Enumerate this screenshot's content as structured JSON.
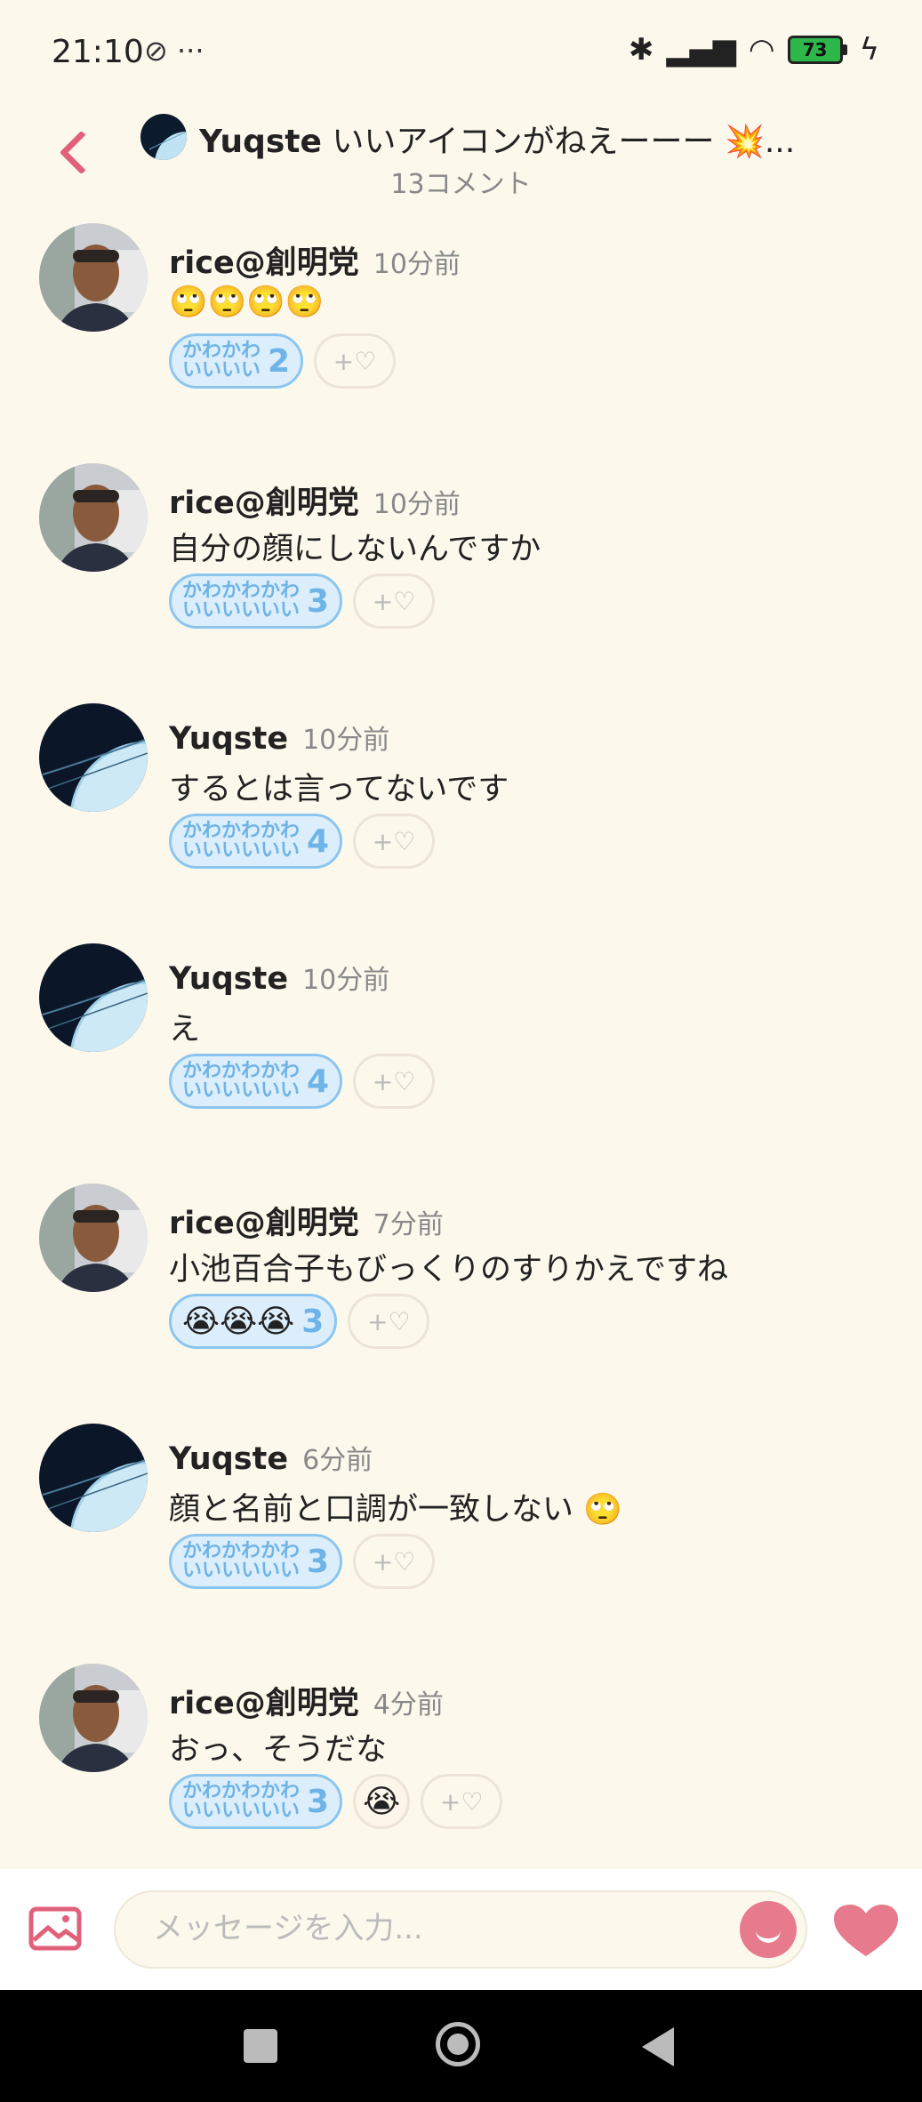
{
  "status_bar": {
    "time": "21:10",
    "battery": "73",
    "more": "···"
  },
  "header": {
    "author": "Yuqste",
    "title": "いいアイコンがねえーーー 💥...",
    "comment_count": "13コメント"
  },
  "comments": [
    {
      "user": "rice@創明党",
      "ago": "10分前",
      "text": "🙄🙄🙄🙄",
      "avatar": "person",
      "reactions": [
        {
          "kind": "kawaii",
          "top": "かわかわ",
          "bottom": "いいいい",
          "count": "2"
        }
      ]
    },
    {
      "user": "rice@創明党",
      "ago": "10分前",
      "text": "自分の顔にしないんですか",
      "avatar": "person",
      "reactions": [
        {
          "kind": "kawaii",
          "top": "かわかわかわ",
          "bottom": "いいいいいい",
          "count": "3"
        }
      ]
    },
    {
      "user": "Yuqste",
      "ago": "10分前",
      "text": "するとは言ってないです",
      "avatar": "planet",
      "reactions": [
        {
          "kind": "kawaii",
          "top": "かわかわかわ",
          "bottom": "いいいいいい",
          "count": "4"
        }
      ]
    },
    {
      "user": "Yuqste",
      "ago": "10分前",
      "text": "え",
      "avatar": "planet",
      "reactions": [
        {
          "kind": "kawaii",
          "top": "かわかわかわ",
          "bottom": "いいいいいい",
          "count": "4"
        }
      ]
    },
    {
      "user": "rice@創明党",
      "ago": "7分前",
      "text": "小池百合子もびっくりのすりかえですね",
      "avatar": "person",
      "reactions": [
        {
          "kind": "emoji",
          "emoji": "😭😭😭",
          "count": "3"
        }
      ]
    },
    {
      "user": "Yuqste",
      "ago": "6分前",
      "text": "顔と名前と口調が一致しない 🙄",
      "avatar": "planet",
      "reactions": [
        {
          "kind": "kawaii",
          "top": "かわかわかわ",
          "bottom": "いいいいいい",
          "count": "3"
        }
      ]
    },
    {
      "user": "rice@創明党",
      "ago": "4分前",
      "text": "おっ、そうだな",
      "avatar": "person",
      "reactions": [
        {
          "kind": "kawaii",
          "top": "かわかわかわ",
          "bottom": "いいいいいい",
          "count": "3"
        },
        {
          "kind": "emoji_plain",
          "emoji": "😭"
        }
      ]
    }
  ],
  "add_reaction_label": "+♡",
  "input": {
    "placeholder": "メッセージを入力..."
  },
  "colors": {
    "accent": "#e1607a",
    "reaction_blue": "#6fb4e8",
    "background": "#fdf8ec"
  }
}
